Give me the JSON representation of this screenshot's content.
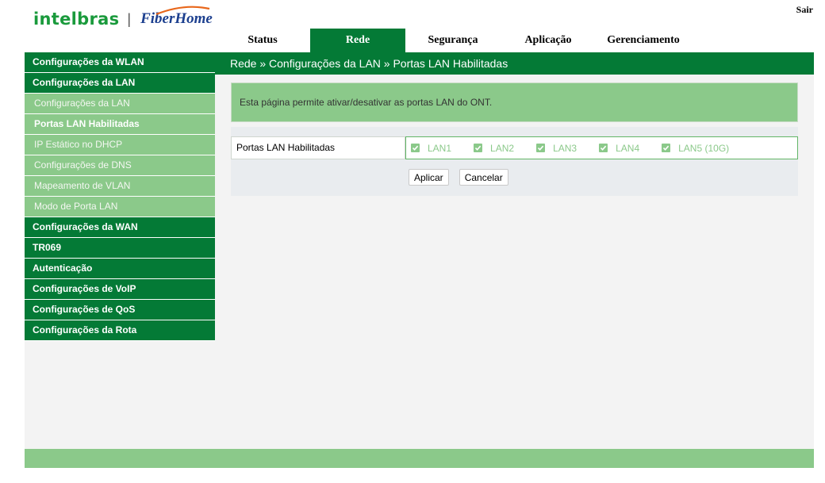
{
  "brand": {
    "name": "intelbras",
    "partner": "FiberHome",
    "separator": "|"
  },
  "header": {
    "logout_label": "Sair"
  },
  "topnav": {
    "tabs": [
      {
        "label": "Status",
        "active": false
      },
      {
        "label": "Rede",
        "active": true
      },
      {
        "label": "Segurança",
        "active": false
      },
      {
        "label": "Aplicação",
        "active": false
      },
      {
        "label": "Gerenciamento",
        "active": false
      }
    ]
  },
  "sidebar": {
    "items": [
      {
        "label": "Configurações da WLAN",
        "level": "top"
      },
      {
        "label": "Configurações da LAN",
        "level": "top"
      },
      {
        "label": "Configurações da LAN",
        "level": "sub"
      },
      {
        "label": "Portas LAN Habilitadas",
        "level": "sub",
        "current": true
      },
      {
        "label": "IP Estático no DHCP",
        "level": "sub"
      },
      {
        "label": "Configurações de DNS",
        "level": "sub"
      },
      {
        "label": "Mapeamento de VLAN",
        "level": "sub"
      },
      {
        "label": "Modo de Porta LAN",
        "level": "sub"
      },
      {
        "label": "Configurações da WAN",
        "level": "top"
      },
      {
        "label": "TR069",
        "level": "top"
      },
      {
        "label": "Autenticação",
        "level": "top"
      },
      {
        "label": "Configurações de VoIP",
        "level": "top"
      },
      {
        "label": "Configurações de QoS",
        "level": "top"
      },
      {
        "label": "Configurações da Rota",
        "level": "top"
      }
    ]
  },
  "main": {
    "breadcrumb": "Rede » Configurações da LAN » Portas LAN Habilitadas",
    "info_text": "Esta página permite ativar/desativar as portas LAN do ONT.",
    "ports_label": "Portas LAN Habilitadas",
    "ports": [
      {
        "label": "LAN1",
        "checked": true
      },
      {
        "label": "LAN2",
        "checked": true
      },
      {
        "label": "LAN3",
        "checked": true
      },
      {
        "label": "LAN4",
        "checked": true
      },
      {
        "label": "LAN5 (10G)",
        "checked": true
      }
    ],
    "apply_label": "Aplicar",
    "cancel_label": "Cancelar"
  },
  "colors": {
    "primary_green": "#047a36",
    "light_green": "#8bc98a",
    "panel_gray": "#f3f3f3",
    "brand_green": "#1a9a3c",
    "fiberhome_blue": "#1c3f8f",
    "fiberhome_orange": "#e8671b"
  }
}
